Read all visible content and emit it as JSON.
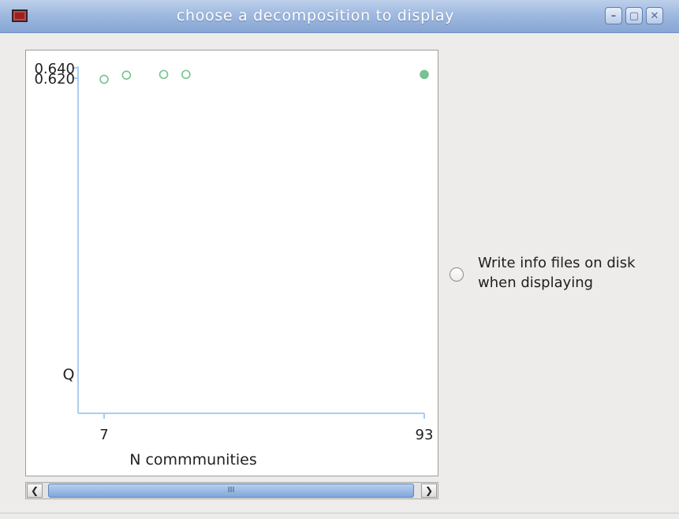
{
  "window": {
    "title": "choose a decomposition to display",
    "minimize_label": "–",
    "maximize_label": "▢",
    "close_label": "✕"
  },
  "option": {
    "label_line1": "Write info files on disk",
    "label_line2": "when displaying",
    "checked": false
  },
  "scrollbar": {
    "left_arrow": "❮",
    "right_arrow": "❯",
    "thumb_grip": "III"
  },
  "chart_data": {
    "type": "scatter",
    "title": "",
    "xlabel": "N commmunities",
    "ylabel": "Q",
    "x_ticks": [
      "7",
      "93"
    ],
    "y_ticks": [
      "0.640",
      "0.620"
    ],
    "xlim": [
      7,
      93
    ],
    "ylim": [
      0.624,
      0.641
    ],
    "points": [
      {
        "x": 7,
        "y": 0.6245,
        "filled": false
      },
      {
        "x": 13,
        "y": 0.6305,
        "filled": false
      },
      {
        "x": 23,
        "y": 0.6315,
        "filled": false
      },
      {
        "x": 29,
        "y": 0.6315,
        "filled": false
      },
      {
        "x": 93,
        "y": 0.6315,
        "filled": true
      }
    ],
    "colors": {
      "axis": "#a9cdf2",
      "point": "#76c290"
    }
  }
}
